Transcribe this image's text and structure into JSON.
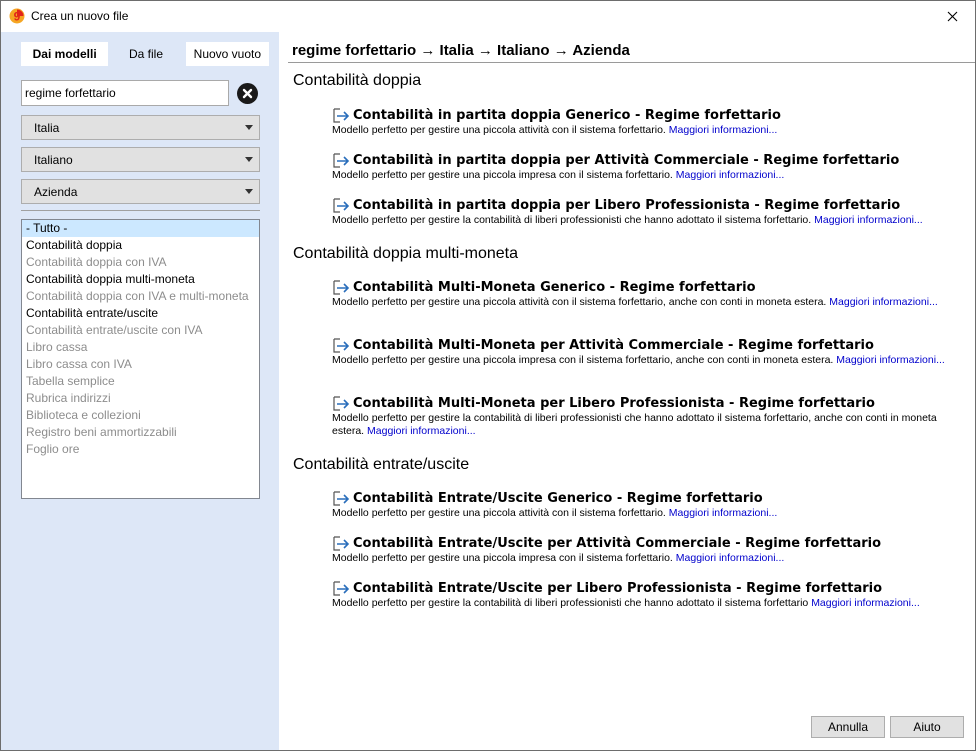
{
  "window": {
    "title": "Crea un nuovo file"
  },
  "left": {
    "tabs": [
      {
        "label": "Dai modelli"
      },
      {
        "label": "Da file"
      },
      {
        "label": "Nuovo vuoto"
      }
    ],
    "search": {
      "value": "regime forfettario"
    },
    "selects": [
      {
        "value": "Italia"
      },
      {
        "value": "Italiano"
      },
      {
        "value": "Azienda"
      }
    ],
    "categories": [
      "- Tutto -",
      "Contabilità doppia",
      "Contabilità doppia con IVA",
      "Contabilità doppia multi-moneta",
      "Contabilità doppia con IVA e multi-moneta",
      "Contabilità entrate/uscite",
      "Contabilità entrate/uscite con IVA",
      "Libro cassa",
      "Libro cassa con IVA",
      "Tabella semplice",
      "Rubrica indirizzi",
      "Biblioteca e collezioni",
      "Registro beni ammortizzabili",
      "Foglio ore"
    ]
  },
  "right": {
    "breadcrumb": "regime forfettario → Italia → Italiano → Azienda",
    "sections": [
      {
        "title": "Contabilità doppia",
        "templates": [
          {
            "title": "Contabilità in partita doppia Generico - Regime forfettario",
            "desc": "Modello perfetto per gestire una piccola attività con il sistema forfettario.",
            "link": "Maggiori informazioni..."
          },
          {
            "title": "Contabilità in partita doppia per Attività Commerciale - Regime forfettario",
            "desc": "Modello perfetto per gestire una piccola impresa con il sistema forfettario.",
            "link": "Maggiori informazioni..."
          },
          {
            "title": "Contabilità in partita doppia per Libero Professionista - Regime forfettario",
            "desc": "Modello perfetto per gestire la contabilità di liberi professionisti che hanno adottato il sistema forfettario.",
            "link": "Maggiori informazioni..."
          }
        ]
      },
      {
        "title": "Contabilità doppia multi-moneta",
        "templates": [
          {
            "title": "Contabilità Multi-Moneta Generico - Regime forfettario",
            "desc": "Modello perfetto per gestire una piccola attività con il sistema forfettario, anche con conti in moneta estera.",
            "link": "Maggiori informazioni..."
          },
          {
            "title": "Contabilità Multi-Moneta per Attività Commerciale - Regime forfettario",
            "desc": "Modello perfetto per gestire una piccola impresa con il sistema forfettario, anche con conti in moneta estera.",
            "link": "Maggiori informazioni..."
          },
          {
            "title": "Contabilità Multi-Moneta per Libero Professionista - Regime forfettario",
            "desc": "Modello perfetto per gestire la contabilità di liberi professionisti che hanno adottato il sistema forfettario, anche con conti in moneta estera.",
            "link": "Maggiori informazioni..."
          }
        ]
      },
      {
        "title": "Contabilità entrate/uscite",
        "templates": [
          {
            "title": "Contabilità Entrate/Uscite Generico - Regime forfettario",
            "desc": "Modello perfetto per gestire una piccola attività con il sistema forfettario.",
            "link": "Maggiori informazioni..."
          },
          {
            "title": "Contabilità Entrate/Uscite per Attività Commerciale - Regime forfettario",
            "desc": "Modello perfetto per gestire una piccola impresa con il sistema forfettario.",
            "link": "Maggiori informazioni..."
          },
          {
            "title": "Contabilità Entrate/Uscite per Libero Professionista - Regime forfettario",
            "desc": "Modello perfetto per gestire la contabilità di liberi professionisti che hanno adottato il sistema forfettario",
            "link": "Maggiori informazioni..."
          }
        ]
      }
    ]
  },
  "buttons": {
    "cancel": "Annulla",
    "help": "Aiuto"
  },
  "colors": {
    "left_panel_bg": "#dde7f7",
    "link": "#0000cc",
    "selected_item": "#cce8ff",
    "disabled_text": "#8d8d8d"
  }
}
